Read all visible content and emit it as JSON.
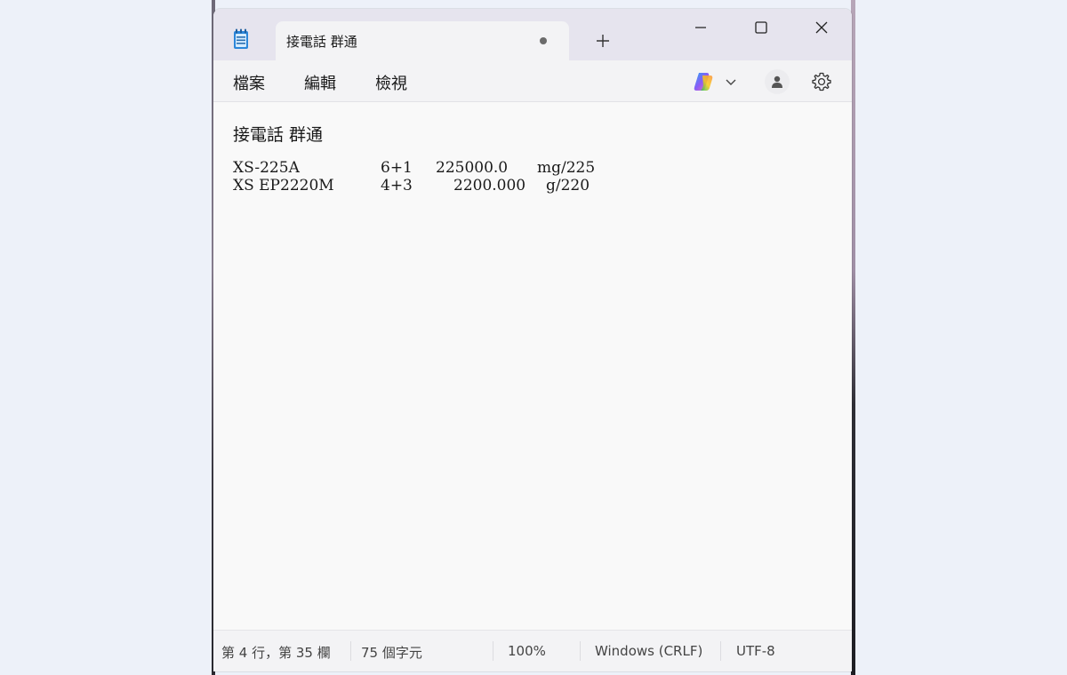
{
  "window": {
    "tab_title": "接電話 群通",
    "new_tab_symbol": "+",
    "unsaved_indicator": "unsaved-dot"
  },
  "menu": {
    "file": "檔案",
    "edit": "編輯",
    "view": "檢視"
  },
  "toolbar_icons": [
    "copilot-icon",
    "chevron-down-icon",
    "account-icon",
    "gear-icon"
  ],
  "document": {
    "heading": "接電話 群通",
    "rows": [
      {
        "model": "XS-225A",
        "config": "6+1",
        "capacity": "225000.0",
        "unit": "mg/225"
      },
      {
        "model": "XS EP2220M",
        "config": "4+3",
        "capacity": "2200.000",
        "unit": "g/220"
      }
    ]
  },
  "status": {
    "position": "第 4 行，第 35 欄",
    "char_count": "75 個字元",
    "zoom": "100%",
    "line_ending": "Windows (CRLF)",
    "encoding": "UTF-8"
  },
  "colors": {
    "titlebar": "#e6e4ee",
    "tab": "#f3f3f5",
    "editor_bg": "#f9f9f9",
    "text": "#1a1a1a"
  }
}
